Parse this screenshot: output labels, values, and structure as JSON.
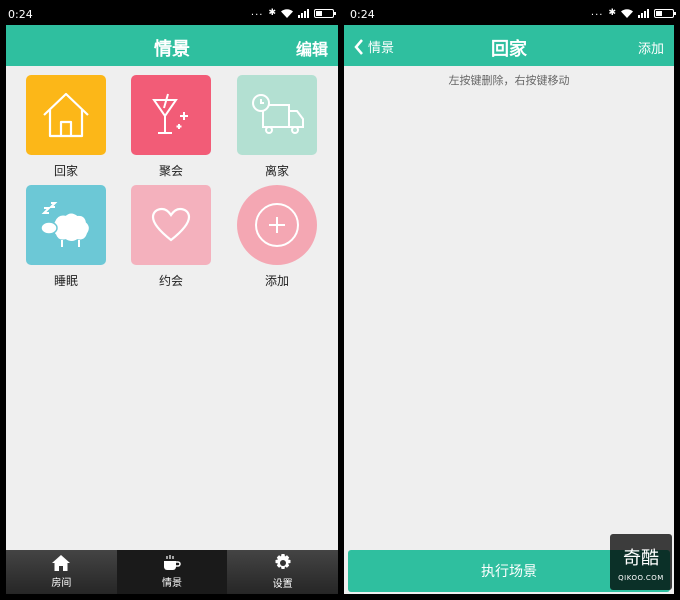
{
  "left": {
    "status": {
      "time": "0:24"
    },
    "header": {
      "title": "情景",
      "edit_label": "编辑"
    },
    "scenes": [
      {
        "label": "回家",
        "color": "#fcb718",
        "icon": "house-icon"
      },
      {
        "label": "聚会",
        "color": "#f25c77",
        "icon": "cocktail-icon"
      },
      {
        "label": "离家",
        "color": "#b3e0d2",
        "icon": "truck-clock-icon"
      },
      {
        "label": "睡眠",
        "color": "#6cc8d6",
        "icon": "sleeping-sheep-icon"
      },
      {
        "label": "约会",
        "color": "#f4b1bd",
        "icon": "heart-icon"
      },
      {
        "label": "添加",
        "color": "#f4a7b3",
        "icon": "plus-circle-icon"
      }
    ],
    "tabs": [
      {
        "label": "房间",
        "icon": "home-icon"
      },
      {
        "label": "情景",
        "icon": "coffee-cup-icon"
      },
      {
        "label": "设置",
        "icon": "gear-icon"
      }
    ]
  },
  "right": {
    "status": {
      "time": "0:24"
    },
    "header": {
      "back_label": "情景",
      "title": "回家",
      "add_label": "添加"
    },
    "hint": "左按键删除，右按键移动",
    "execute_label": "执行场景"
  },
  "watermark": {
    "big": "奇酷",
    "small": "QIKOO.COM"
  },
  "colors": {
    "accent": "#2fbf9f",
    "background": "#efefef"
  }
}
